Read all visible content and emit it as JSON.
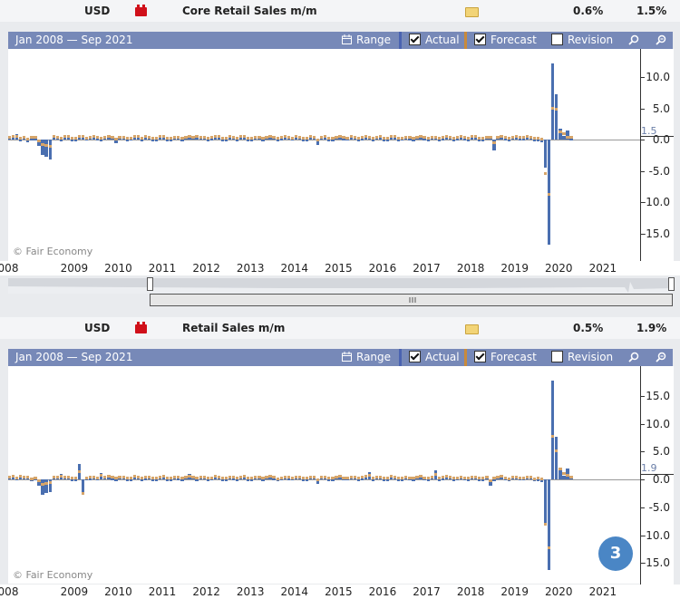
{
  "panels": [
    {
      "currency": "USD",
      "event_name": "Core Retail Sales m/m",
      "actual": "0.6%",
      "forecast": "1.5%",
      "toolbar": {
        "date_range": "Jan 2008 — Sep 2021",
        "range_label": "Range",
        "actual_label": "Actual",
        "forecast_label": "Forecast",
        "revision_label": "Revision"
      },
      "latest_value_label": "1.5",
      "watermark": "© Fair Economy"
    },
    {
      "currency": "USD",
      "event_name": "Retail Sales m/m",
      "actual": "0.5%",
      "forecast": "1.9%",
      "toolbar": {
        "date_range": "Jan 2008 — Sep 2021",
        "range_label": "Range",
        "actual_label": "Actual",
        "forecast_label": "Forecast",
        "revision_label": "Revision"
      },
      "latest_value_label": "1.9",
      "watermark": "© Fair Economy"
    }
  ],
  "badge_number": "3",
  "colors": {
    "actual": "#4a6fb0",
    "forecast": "#d6a56a",
    "toolbar": "#7789b8"
  },
  "chart_data": [
    {
      "type": "bar",
      "title": "Core Retail Sales m/m",
      "x_ticks": [
        "008",
        "2009",
        "2010",
        "2011",
        "2012",
        "2013",
        "2014",
        "2015",
        "2016",
        "2017",
        "2018",
        "2019",
        "2020",
        "2021"
      ],
      "y_ticks": [
        10.0,
        5.0,
        0.0,
        -5.0,
        -10.0,
        -15.0
      ],
      "ylim": [
        -17.5,
        14.0
      ],
      "series": [
        {
          "name": "Actual",
          "points": [
            [
              "2008-03",
              0.8
            ],
            [
              "2008-06",
              -0.5
            ],
            [
              "2008-09",
              -1.0
            ],
            [
              "2008-10",
              -2.5
            ],
            [
              "2008-11",
              -2.8
            ],
            [
              "2008-12",
              -3.2
            ],
            [
              "2009-04",
              0.5
            ],
            [
              "2009-08",
              0.7
            ],
            [
              "2010-06",
              -0.6
            ],
            [
              "2011-02",
              0.7
            ],
            [
              "2012-04",
              0.6
            ],
            [
              "2015-01",
              -0.9
            ],
            [
              "2016-06",
              0.5
            ],
            [
              "2019-01",
              -1.8
            ],
            [
              "2020-02",
              -0.4
            ],
            [
              "2020-03",
              -4.5
            ],
            [
              "2020-04",
              -16.8
            ],
            [
              "2020-05",
              12.2
            ],
            [
              "2020-06",
              7.3
            ],
            [
              "2020-07",
              1.7
            ],
            [
              "2020-08",
              0.6
            ],
            [
              "2020-09",
              1.4
            ],
            [
              "2020-10",
              0.1
            ]
          ]
        },
        {
          "name": "Forecast",
          "points": [
            [
              "2020-03",
              -5.5
            ],
            [
              "2020-04",
              -8.8
            ],
            [
              "2020-05",
              5.0
            ],
            [
              "2020-06",
              4.8
            ],
            [
              "2020-07",
              1.2
            ],
            [
              "2020-08",
              0.9
            ],
            [
              "2020-09",
              0.4
            ]
          ]
        }
      ],
      "latest_forecast": 1.5
    },
    {
      "type": "bar",
      "title": "Retail Sales m/m",
      "x_ticks": [
        "008",
        "2009",
        "2010",
        "2011",
        "2012",
        "2013",
        "2014",
        "2015",
        "2016",
        "2017",
        "2018",
        "2019",
        "2020",
        "2021"
      ],
      "y_ticks": [
        15.0,
        10.0,
        5.0,
        0.0,
        -5.0,
        -10.0,
        -15.0
      ],
      "ylim": [
        -18.5,
        18.5
      ],
      "series": [
        {
          "name": "Actual",
          "points": [
            [
              "2008-01",
              0.3
            ],
            [
              "2008-04",
              0.7
            ],
            [
              "2008-07",
              -0.4
            ],
            [
              "2008-09",
              -1.2
            ],
            [
              "2008-10",
              -2.8
            ],
            [
              "2008-11",
              -2.5
            ],
            [
              "2008-12",
              -2.2
            ],
            [
              "2009-03",
              0.9
            ],
            [
              "2009-08",
              2.8
            ],
            [
              "2009-09",
              -2.2
            ],
            [
              "2010-02",
              1.2
            ],
            [
              "2012-02",
              0.9
            ],
            [
              "2015-01",
              -0.8
            ],
            [
              "2016-03",
              1.3
            ],
            [
              "2017-09",
              1.6
            ],
            [
              "2018-12",
              -1.2
            ],
            [
              "2020-02",
              -0.5
            ],
            [
              "2020-03",
              -8.2
            ],
            [
              "2020-04",
              -16.2
            ],
            [
              "2020-05",
              17.8
            ],
            [
              "2020-06",
              7.6
            ],
            [
              "2020-07",
              1.8
            ],
            [
              "2020-08",
              0.7
            ],
            [
              "2020-09",
              1.9
            ],
            [
              "2020-10",
              0.3
            ]
          ]
        },
        {
          "name": "Forecast",
          "points": [
            [
              "2009-09",
              -2.5
            ],
            [
              "2020-03",
              -8.0
            ],
            [
              "2020-04",
              -12.3
            ],
            [
              "2020-05",
              7.7
            ],
            [
              "2020-06",
              5.2
            ],
            [
              "2020-07",
              1.9
            ],
            [
              "2020-08",
              1.1
            ],
            [
              "2020-09",
              0.8
            ]
          ]
        }
      ],
      "latest_forecast": 1.9
    }
  ]
}
